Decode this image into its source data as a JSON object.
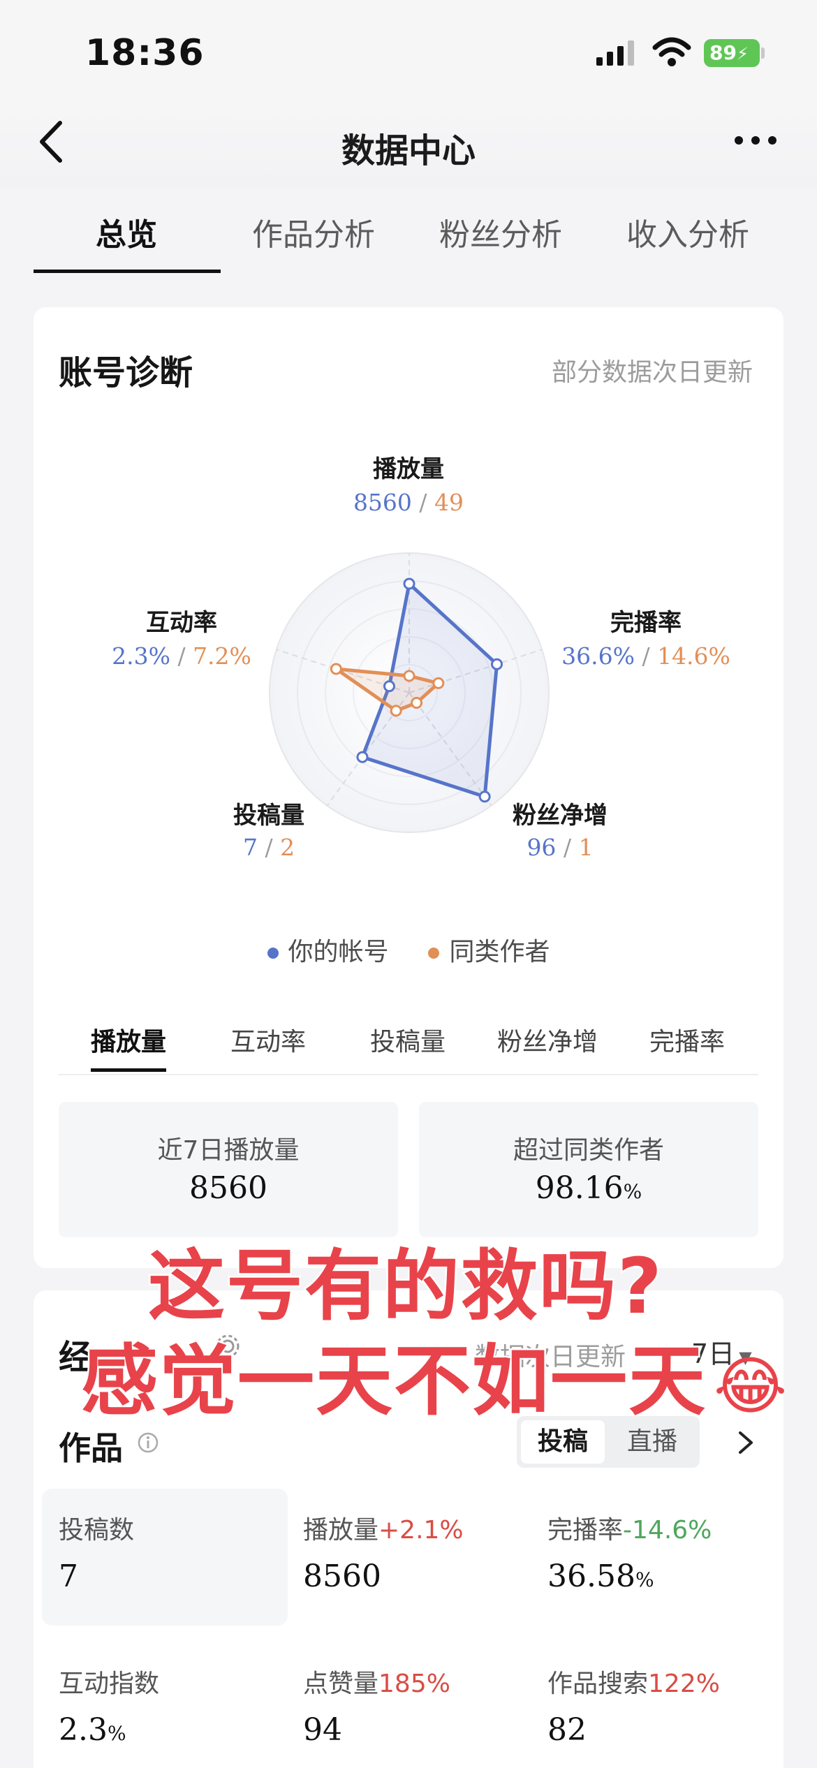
{
  "status_bar": {
    "time": "18:36",
    "battery": "89"
  },
  "nav": {
    "title": "数据中心"
  },
  "tabs": [
    {
      "label": "总览",
      "active": true
    },
    {
      "label": "作品分析",
      "active": false
    },
    {
      "label": "粉丝分析",
      "active": false
    },
    {
      "label": "收入分析",
      "active": false
    }
  ],
  "diagnosis": {
    "title": "账号诊断",
    "note": "部分数据次日更新",
    "axes": [
      {
        "label": "播放量",
        "yours": "8560",
        "peers": "49"
      },
      {
        "label": "完播率",
        "yours": "36.6%",
        "peers": "14.6%"
      },
      {
        "label": "粉丝净增",
        "yours": "96",
        "peers": "1"
      },
      {
        "label": "投稿量",
        "yours": "7",
        "peers": "2"
      },
      {
        "label": "互动率",
        "yours": "2.3%",
        "peers": "7.2%"
      }
    ],
    "slash": "/",
    "legend": {
      "yours": "你的帐号",
      "peers": "同类作者"
    },
    "colors": {
      "yours": "#5674c9",
      "peers": "#e28f57"
    },
    "sub_tabs": [
      "播放量",
      "互动率",
      "投稿量",
      "粉丝净增",
      "完播率"
    ],
    "stats": [
      {
        "label": "近7日播放量",
        "value": "8560",
        "unit": ""
      },
      {
        "label": "超过同类作者",
        "value": "98.16",
        "unit": "%"
      }
    ]
  },
  "overlay": {
    "line1": "这号有的救吗?",
    "line2": "感觉一天不如一天",
    "emoji": "😂"
  },
  "works_card": {
    "partial_title": "经",
    "partial_note": "数据次日更新",
    "period": "7日",
    "section_title": "作品",
    "toggle": {
      "on": "投稿",
      "off": "直播"
    },
    "metrics": [
      {
        "label": "投稿数",
        "change": "",
        "trend": "",
        "value": "7",
        "unit": ""
      },
      {
        "label": "播放量",
        "change": "+2.1%",
        "trend": "up",
        "value": "8560",
        "unit": ""
      },
      {
        "label": "完播率",
        "change": "-14.6%",
        "trend": "down",
        "value": "36.58",
        "unit": "%"
      },
      {
        "label": "互动指数",
        "change": "",
        "trend": "",
        "value": "2.3",
        "unit": "%"
      },
      {
        "label": "点赞量",
        "change": "185%",
        "trend": "up",
        "value": "94",
        "unit": ""
      },
      {
        "label": "作品搜索",
        "change": "122%",
        "trend": "up",
        "value": "82",
        "unit": ""
      }
    ]
  }
}
